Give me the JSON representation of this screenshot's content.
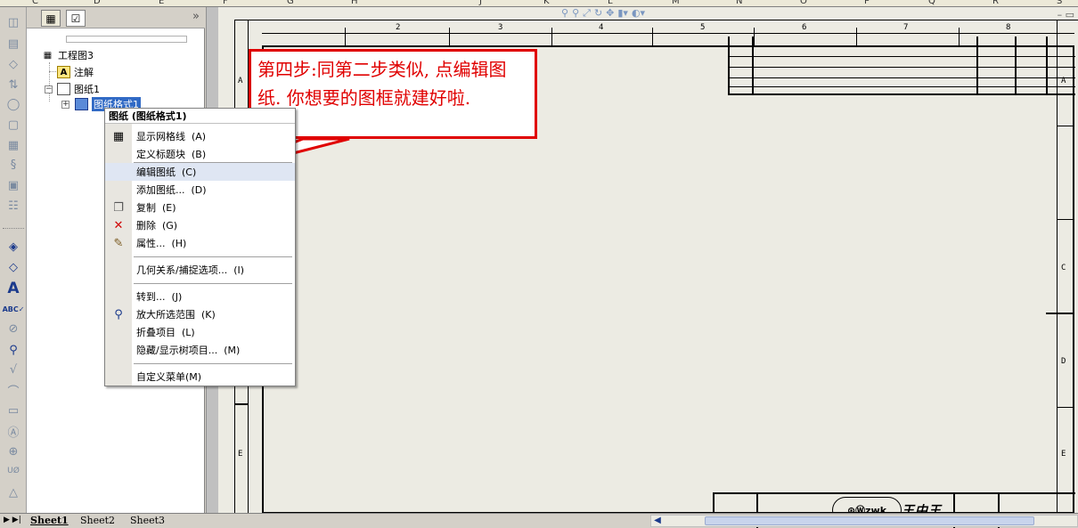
{
  "column_ruler": [
    "C",
    "D",
    "E",
    "F",
    "G",
    "H",
    "J",
    "K",
    "L",
    "M",
    "N",
    "O",
    "P",
    "Q",
    "R",
    "S"
  ],
  "tree": {
    "root": "工程图3",
    "annotations": "注解",
    "sheet": "图纸1",
    "sheet_format": "图纸格式1"
  },
  "context_menu": {
    "title": "图纸 (图纸格式1)",
    "items": [
      {
        "label": "显示网格线  (A)",
        "icon": "grid-icon"
      },
      {
        "label": "定义标题块  (B)",
        "icon": ""
      },
      {
        "label": "编辑图纸  (C)",
        "icon": "",
        "highlighted": true
      },
      {
        "label": "添加图纸...  (D)",
        "icon": ""
      },
      {
        "label": "复制  (E)",
        "icon": "copy-icon"
      },
      {
        "label": "删除  (G)",
        "icon": "delete-icon"
      },
      {
        "label": "属性...  (H)",
        "icon": "properties-icon"
      },
      {
        "label": "几何关系/捕捉选项...  (I)",
        "icon": ""
      },
      {
        "label": "转到...  (J)",
        "icon": ""
      },
      {
        "label": "放大所选范围  (K)",
        "icon": "zoom-icon"
      },
      {
        "label": "折叠项目  (L)",
        "icon": ""
      },
      {
        "label": "隐藏/显示树项目...  (M)",
        "icon": ""
      },
      {
        "label": "自定义菜单(M)",
        "icon": ""
      }
    ]
  },
  "callout_text": "第四步:同第二步类似, 点编辑图纸. 你想要的图框就建好啦.",
  "drawing": {
    "zone_numbers": [
      "2",
      "3",
      "4",
      "5",
      "6",
      "7",
      "8"
    ],
    "zone_letters_left": [
      "A",
      "E"
    ],
    "zone_letters_right": [
      "A",
      "C",
      "D",
      "E"
    ]
  },
  "sheet_tabs": [
    "Sheet1",
    "Sheet2",
    "Sheet3"
  ],
  "colors": {
    "callout_red": "#e00000",
    "selection_blue": "#316ac5"
  }
}
